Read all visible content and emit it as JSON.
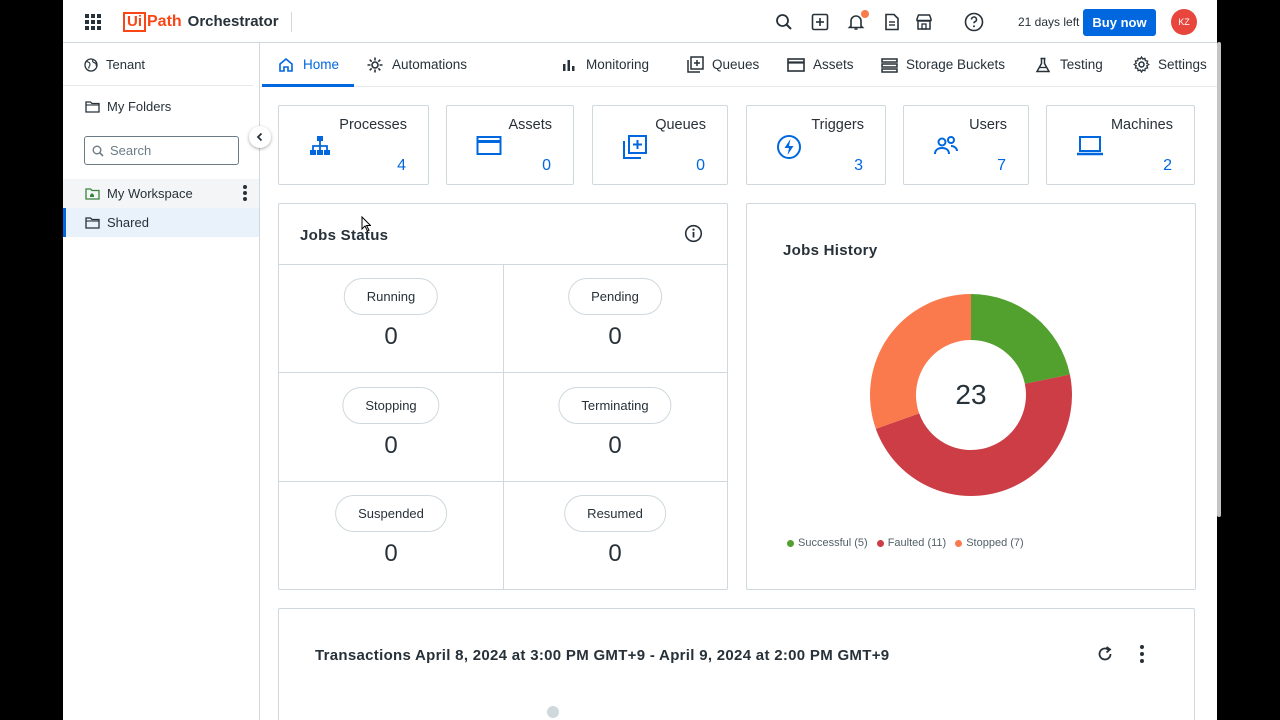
{
  "app": {
    "brand_box": "Ui",
    "brand_rest": "Path",
    "product": "Orchestrator",
    "trial_text": "21 days left",
    "buy_label": "Buy now",
    "avatar_initials": "KZ"
  },
  "sidebar": {
    "tenant_label": "Tenant",
    "folders_label": "My Folders",
    "search_placeholder": "Search",
    "items": [
      {
        "label": "My Workspace"
      },
      {
        "label": "Shared"
      }
    ]
  },
  "nav": {
    "tabs": [
      {
        "label": "Home",
        "icon": "home-icon"
      },
      {
        "label": "Automations",
        "icon": "automations-icon"
      },
      {
        "label": "Monitoring",
        "icon": "monitoring-icon"
      },
      {
        "label": "Queues",
        "icon": "queues-icon"
      },
      {
        "label": "Assets",
        "icon": "assets-icon"
      },
      {
        "label": "Storage Buckets",
        "icon": "storage-icon"
      },
      {
        "label": "Testing",
        "icon": "testing-icon"
      },
      {
        "label": "Settings",
        "icon": "settings-icon"
      }
    ]
  },
  "stats": [
    {
      "title": "Processes",
      "value": "4",
      "icon": "processes-icon"
    },
    {
      "title": "Assets",
      "value": "0",
      "icon": "assets-icon"
    },
    {
      "title": "Queues",
      "value": "0",
      "icon": "queues-icon"
    },
    {
      "title": "Triggers",
      "value": "3",
      "icon": "triggers-icon"
    },
    {
      "title": "Users",
      "value": "7",
      "icon": "users-icon"
    },
    {
      "title": "Machines",
      "value": "2",
      "icon": "machines-icon"
    }
  ],
  "jobs_status": {
    "title": "Jobs Status",
    "cells": [
      {
        "label": "Running",
        "value": "0"
      },
      {
        "label": "Pending",
        "value": "0"
      },
      {
        "label": "Stopping",
        "value": "0"
      },
      {
        "label": "Terminating",
        "value": "0"
      },
      {
        "label": "Suspended",
        "value": "0"
      },
      {
        "label": "Resumed",
        "value": "0"
      }
    ]
  },
  "jobs_history": {
    "title": "Jobs History",
    "total": "23",
    "legend": [
      {
        "label": "Successful (5)",
        "color": "#52a02e"
      },
      {
        "label": "Faulted (11)",
        "color": "#cc3d45"
      },
      {
        "label": "Stopped (7)",
        "color": "#fa7a4e"
      }
    ]
  },
  "chart_data": {
    "type": "pie",
    "categories": [
      "Successful",
      "Faulted",
      "Stopped"
    ],
    "values": [
      5,
      11,
      7
    ],
    "colors": [
      "#52a02e",
      "#cc3d45",
      "#fa7a4e"
    ],
    "title": "Jobs History",
    "center_label": "23"
  },
  "transactions": {
    "title": "Transactions April 8, 2024 at 3:00 PM GMT+9 - April 9, 2024 at 2:00 PM GMT+9"
  }
}
